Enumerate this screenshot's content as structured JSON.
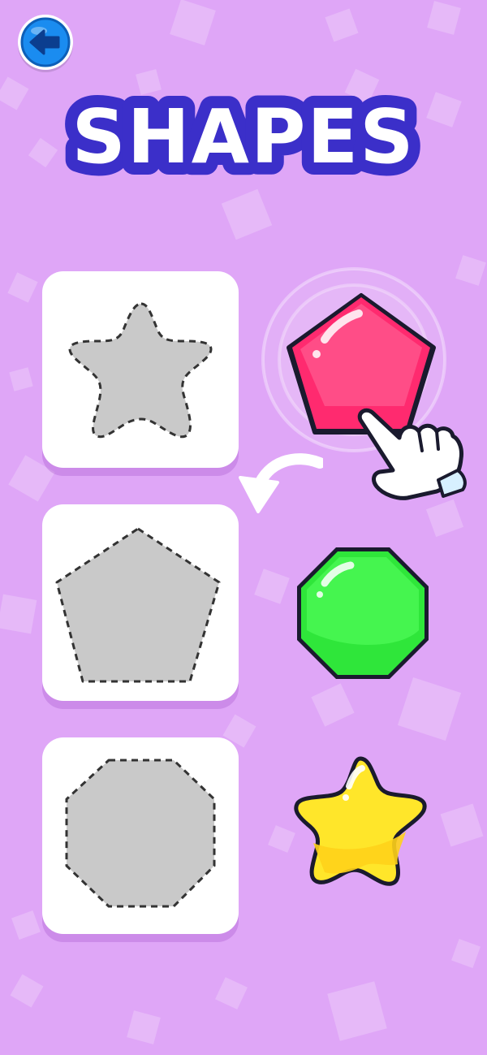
{
  "page": {
    "title": "SHAPES"
  },
  "nav": {
    "back_icon": "back-arrow-icon"
  },
  "colors": {
    "background": "#dfa6f7",
    "title_fill": "#ffffff",
    "title_outline": "#3b2fc9",
    "back_button": "#1a8cf0",
    "pink_shape": "#ff2a6f",
    "green_shape": "#2fe63a",
    "yellow_shape": "#ffe62a",
    "slot_fill": "#c9c9c9"
  },
  "targets": [
    {
      "shape": "star"
    },
    {
      "shape": "pentagon"
    },
    {
      "shape": "octagon"
    }
  ],
  "pieces": [
    {
      "shape": "pentagon",
      "color": "pink"
    },
    {
      "shape": "octagon",
      "color": "green"
    },
    {
      "shape": "star",
      "color": "yellow"
    }
  ],
  "hint": {
    "icon": "pointing-hand-icon",
    "arrow": "curved-arrow-icon"
  }
}
